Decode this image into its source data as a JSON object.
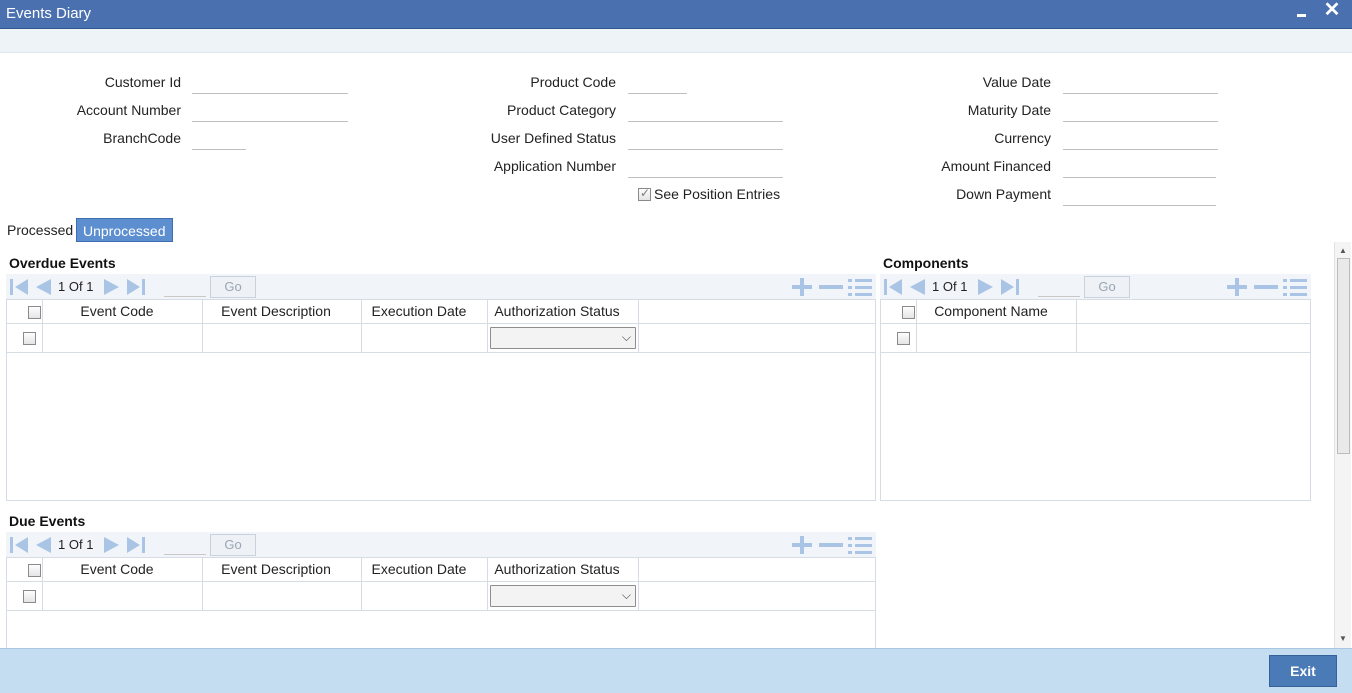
{
  "window": {
    "title": "Events Diary",
    "close_glyph": "✕"
  },
  "form": {
    "customer_id_label": "Customer Id",
    "account_number_label": "Account Number",
    "branch_code_label": "BranchCode",
    "product_code_label": "Product Code",
    "product_category_label": "Product Category",
    "user_defined_status_label": "User Defined Status",
    "application_number_label": "Application Number",
    "see_position_entries_label": "See Position Entries",
    "see_position_entries_checked": true,
    "value_date_label": "Value Date",
    "maturity_date_label": "Maturity Date",
    "currency_label": "Currency",
    "amount_financed_label": "Amount Financed",
    "down_payment_label": "Down Payment"
  },
  "tabs": [
    {
      "label": "Processed",
      "active": false
    },
    {
      "label": "Unprocessed",
      "active": true
    }
  ],
  "overdue": {
    "title": "Overdue Events",
    "page_current": "1",
    "page_of": "Of",
    "page_total": "1",
    "go_label": "Go",
    "columns": [
      "Event Code",
      "Event Description",
      "Execution Date",
      "Authorization Status"
    ]
  },
  "components": {
    "title": "Components",
    "page_current": "1",
    "page_of": "Of",
    "page_total": "1",
    "go_label": "Go",
    "columns": [
      "Component Name"
    ]
  },
  "due": {
    "title": "Due Events",
    "page_current": "1",
    "page_of": "Of",
    "page_total": "1",
    "go_label": "Go",
    "columns": [
      "Event Code",
      "Event Description",
      "Execution Date",
      "Authorization Status"
    ]
  },
  "footer": {
    "exit_label": "Exit"
  },
  "colors": {
    "titlebar": "#4a70b0",
    "active_tab": "#5d8fd0",
    "footer": "#c5ddf1",
    "exit_button": "#4b7bb6",
    "nav_icon": "#a9c4e4"
  }
}
